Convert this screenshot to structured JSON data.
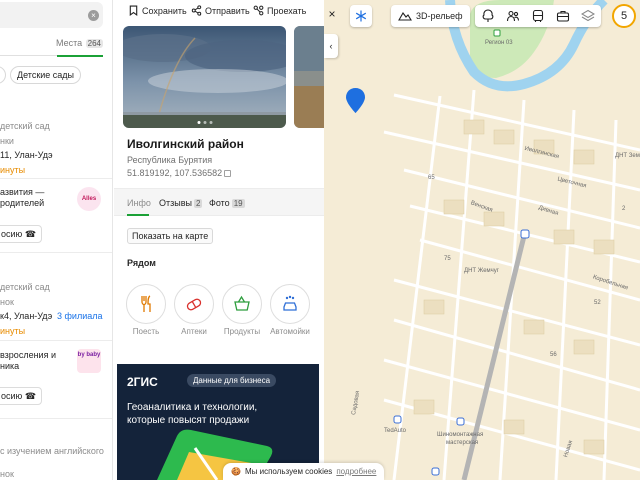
{
  "results": {
    "search_clear": "×",
    "places_tab_label": "Места",
    "places_tab_count": "264",
    "chip_previous": "",
    "chip_label": "Детские сады",
    "items": [
      {
        "category": "детский сад",
        "meta": "нки",
        "address": "11, Улан-Удэ",
        "hours": "инуты"
      },
      {
        "ad_title_1": "азвития —",
        "ad_title_2": "родителей",
        "ad_logo": "Alles",
        "call_label": "осию"
      },
      {
        "category": "детский сад",
        "meta": "нок",
        "address": "к4, Улан-Удэ",
        "branches": "3 филиала",
        "hours": "инуты"
      },
      {
        "ad_title_1": "взросления и",
        "ad_title_2": "ника",
        "ad_logo": "by baby",
        "call_label": "осию"
      },
      {
        "category": "с изучением английского",
        "meta": "нок"
      }
    ]
  },
  "card": {
    "toolbar": {
      "save": "Сохранить",
      "share": "Отправить",
      "route": "Проехать"
    },
    "title": "Иволгинский район",
    "region": "Республика Бурятия",
    "coords": "51.819192, 107.536582",
    "tabs": [
      {
        "label": "Инфо",
        "count": ""
      },
      {
        "label": "Отзывы",
        "count": "2"
      },
      {
        "label": "Фото",
        "count": "19"
      }
    ],
    "show_on_map": "Показать на карте",
    "nearby_title": "Рядом",
    "nearby": [
      {
        "label": "Поесть",
        "icon": "fork-knife-icon"
      },
      {
        "label": "Аптеки",
        "icon": "pills-icon"
      },
      {
        "label": "Продукты",
        "icon": "basket-icon"
      },
      {
        "label": "Автомойки",
        "icon": "car-wash-icon"
      }
    ],
    "ad": {
      "brand": "2ГИС",
      "pill": "Данные для бизнеса",
      "line1": "Геоаналитика и технологии,",
      "line2": "которые повысят продажи"
    }
  },
  "map": {
    "close": "×",
    "collapse": "‹",
    "relief_label": "3D-рельеф",
    "zoom_level": "5",
    "labels": {
      "region": "Регион 03",
      "dnt_zem": "ДНТ Зем",
      "ivolginskaya": "Иволгинская",
      "tsvetochnaya": "Цветочная",
      "venskaya": "Венская",
      "divnaya": "Дивная",
      "dnt_zhemchug": "ДНТ Жемчуг",
      "korobelnaya": "Коробельная",
      "sadovaya": "Садовая",
      "tedauto": "TedAuto",
      "tire_shop_1": "Шиномонтажная",
      "tire_shop_2": "мастерская",
      "novaya": "Новая",
      "n52": "52",
      "n56": "56",
      "n65": "65",
      "n75": "75",
      "n2": "2"
    },
    "cookie_text": "Мы используем cookies",
    "cookie_more": "подробнее"
  }
}
